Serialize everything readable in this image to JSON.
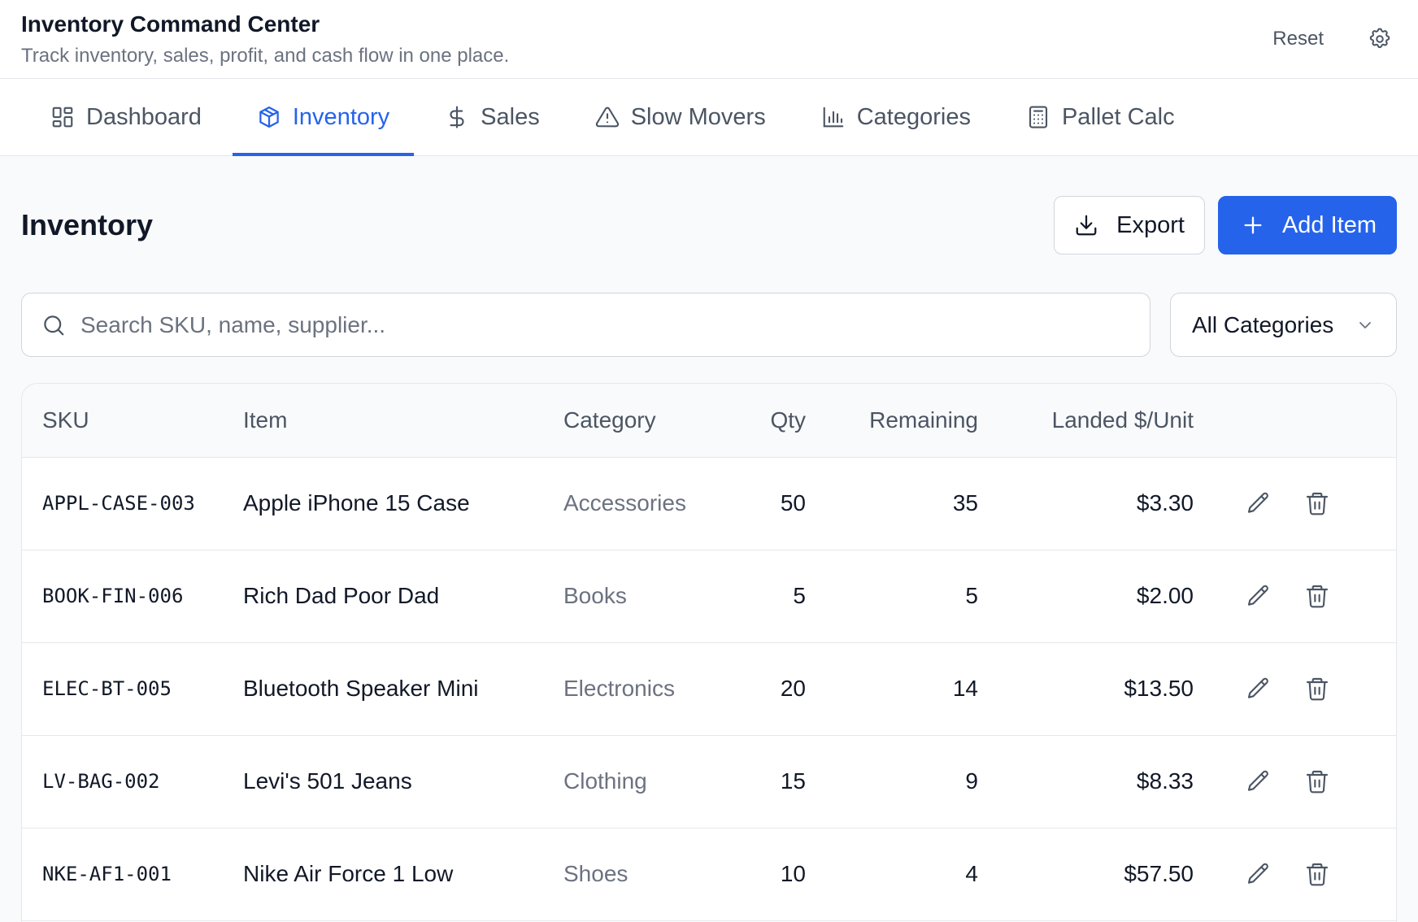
{
  "header": {
    "title": "Inventory Command Center",
    "subtitle": "Track inventory, sales, profit, and cash flow in one place.",
    "reset_label": "Reset"
  },
  "tabs": [
    {
      "label": "Dashboard",
      "icon": "grid-icon"
    },
    {
      "label": "Inventory",
      "icon": "box-icon",
      "active": true
    },
    {
      "label": "Sales",
      "icon": "dollar-icon"
    },
    {
      "label": "Slow Movers",
      "icon": "warning-icon"
    },
    {
      "label": "Categories",
      "icon": "bar-chart-icon"
    },
    {
      "label": "Pallet Calc",
      "icon": "calculator-icon"
    }
  ],
  "page": {
    "title": "Inventory",
    "export_label": "Export",
    "add_label": "Add Item"
  },
  "search": {
    "placeholder": "Search SKU, name, supplier...",
    "value": ""
  },
  "category_filter": {
    "selected": "All Categories"
  },
  "table": {
    "columns": [
      "SKU",
      "Item",
      "Category",
      "Qty",
      "Remaining",
      "Landed $/Unit"
    ],
    "rows": [
      {
        "sku": "APPL-CASE-003",
        "item": "Apple iPhone 15 Case",
        "category": "Accessories",
        "qty": "50",
        "remaining": "35",
        "cost": "$3.30"
      },
      {
        "sku": "BOOK-FIN-006",
        "item": "Rich Dad Poor Dad",
        "category": "Books",
        "qty": "5",
        "remaining": "5",
        "cost": "$2.00"
      },
      {
        "sku": "ELEC-BT-005",
        "item": "Bluetooth Speaker Mini",
        "category": "Electronics",
        "qty": "20",
        "remaining": "14",
        "cost": "$13.50"
      },
      {
        "sku": "LV-BAG-002",
        "item": "Levi's 501 Jeans",
        "category": "Clothing",
        "qty": "15",
        "remaining": "9",
        "cost": "$8.33"
      },
      {
        "sku": "NKE-AF1-001",
        "item": "Nike Air Force 1 Low",
        "category": "Shoes",
        "qty": "10",
        "remaining": "4",
        "cost": "$57.50"
      }
    ]
  },
  "colors": {
    "accent": "#2563eb",
    "text": "#111827",
    "muted": "#6b7280",
    "border": "#e5e7eb"
  }
}
